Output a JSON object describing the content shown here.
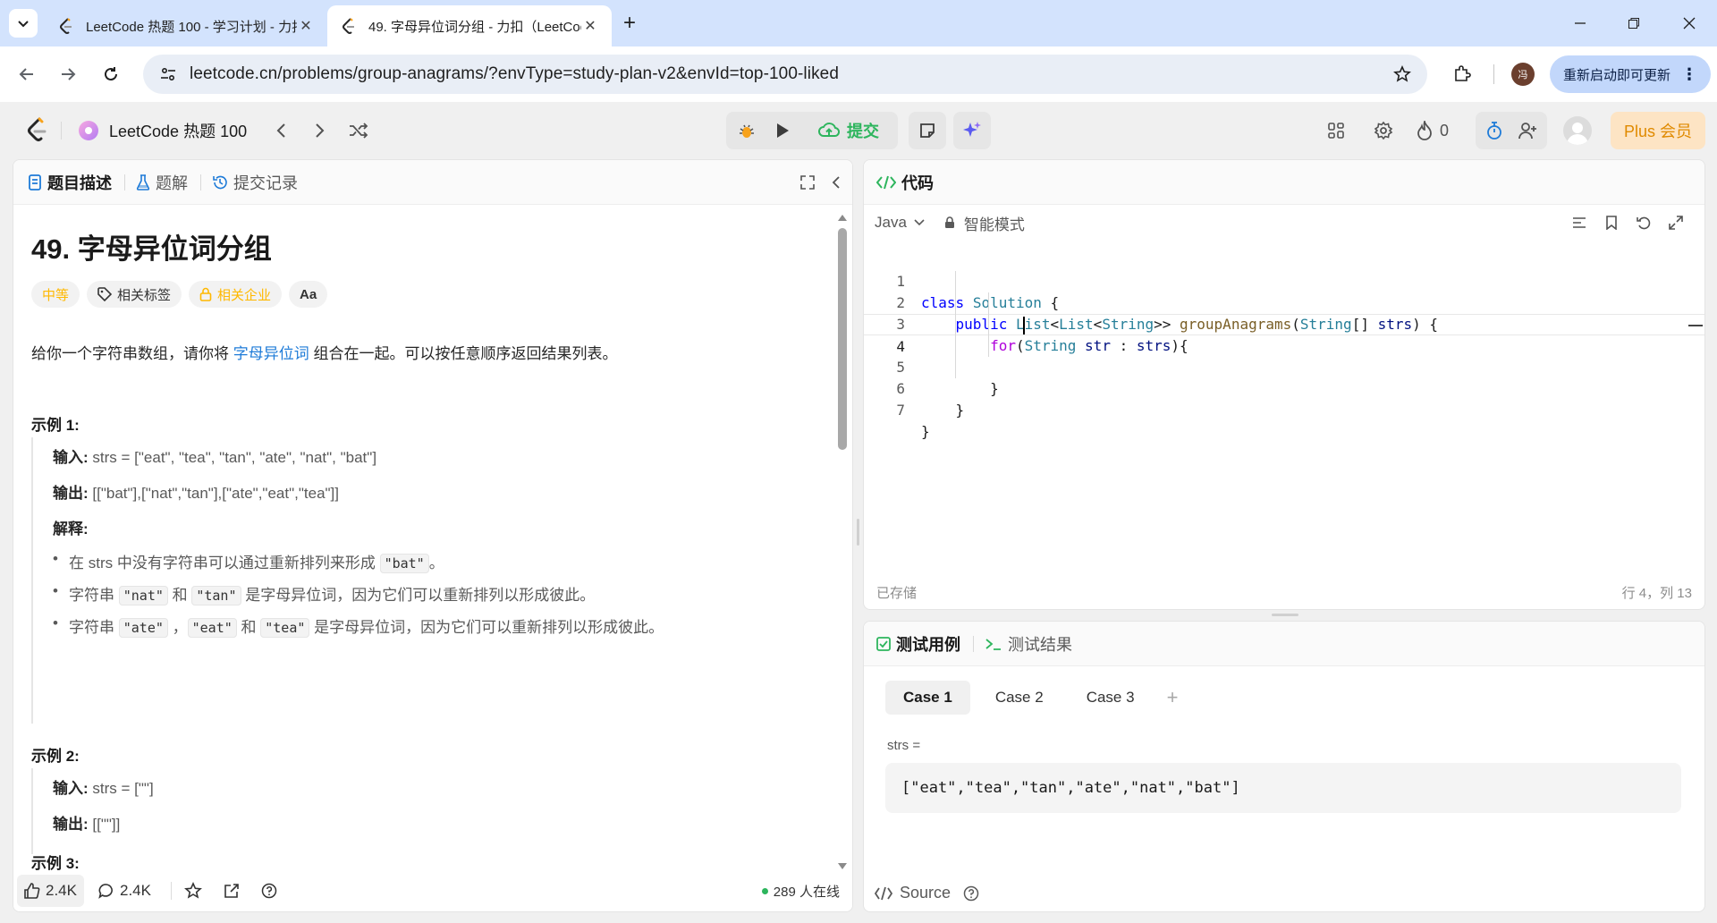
{
  "browser": {
    "tabs": [
      {
        "title": "LeetCode 热题 100 - 学习计划 - 力扣"
      },
      {
        "title": "49. 字母异位词分组 - 力扣（LeetCode）"
      }
    ],
    "url": "leetcode.cn/problems/group-anagrams/?envType=study-plan-v2&envId=top-100-liked",
    "profile_initial": "冯",
    "update_label": "重新启动即可更新"
  },
  "header": {
    "study_plan": "LeetCode 热题 100",
    "submit_label": "提交",
    "streak_count": "0",
    "plus_label": "Plus 会员"
  },
  "left_tabs": [
    {
      "label": "题目描述"
    },
    {
      "label": "题解"
    },
    {
      "label": "提交记录"
    }
  ],
  "problem": {
    "title": "49. 字母异位词分组",
    "difficulty": "中等",
    "tag_topics": "相关标签",
    "tag_companies": "相关企业",
    "tag_lang": "Aa",
    "desc_before": "给你一个字符串数组，请你将 ",
    "desc_keyword": "字母异位词",
    "desc_after": " 组合在一起。可以按任意顺序返回结果列表。",
    "input_label": "输入:",
    "output_label": "输出:",
    "explain_label": "解释:",
    "examples": [
      {
        "heading": "示例 1:",
        "input": " strs = [\"eat\", \"tea\", \"tan\", \"ate\", \"nat\", \"bat\"]",
        "output": " [[\"bat\"],[\"nat\",\"tan\"],[\"ate\",\"eat\",\"tea\"]]"
      },
      {
        "heading": "示例 2:",
        "input": " strs = [\"\"]",
        "output": " [[\"\"]]"
      },
      {
        "heading": "示例 3:"
      }
    ],
    "explanation": {
      "b1_pre": "在 strs 中没有字符串可以通过重新排列来形成 ",
      "b1_code": "\"bat\"",
      "b1_post": "。",
      "b2_pre": "字符串 ",
      "b2_code1": "\"nat\"",
      "b2_mid": " 和 ",
      "b2_code2": "\"tan\"",
      "b2_post": " 是字母异位词，因为它们可以重新排列以形成彼此。",
      "b3_pre": "字符串 ",
      "b3_code1": "\"ate\"",
      "b3_sep": " ，",
      "b3_code2": "\"eat\"",
      "b3_mid": " 和 ",
      "b3_code3": "\"tea\"",
      "b3_post": " 是字母异位词，因为它们可以重新排列以形成彼此。"
    }
  },
  "left_footer": {
    "likes": "2.4K",
    "comments": "2.4K",
    "online": "289 人在线"
  },
  "code_panel": {
    "title": "代码",
    "language": "Java",
    "mode": "智能模式",
    "saved": "已存储",
    "cursor": "行 4，列 13",
    "line_numbers": [
      "1",
      "2",
      "3",
      "4",
      "5",
      "6",
      "7"
    ]
  },
  "test_panel": {
    "tab_cases": "测试用例",
    "tab_results": "测试结果",
    "cases": [
      {
        "label": "Case 1"
      },
      {
        "label": "Case 2"
      },
      {
        "label": "Case 3"
      }
    ],
    "var_name": "strs =",
    "var_value": "[\"eat\",\"tea\",\"tan\",\"ate\",\"nat\",\"bat\"]",
    "source_label": "Source"
  },
  "colors": {
    "accent_blue": "#1e7bd8",
    "difficulty_orange": "#ffb800",
    "submit_green": "#2db55d",
    "online_green": "#2db55d"
  }
}
